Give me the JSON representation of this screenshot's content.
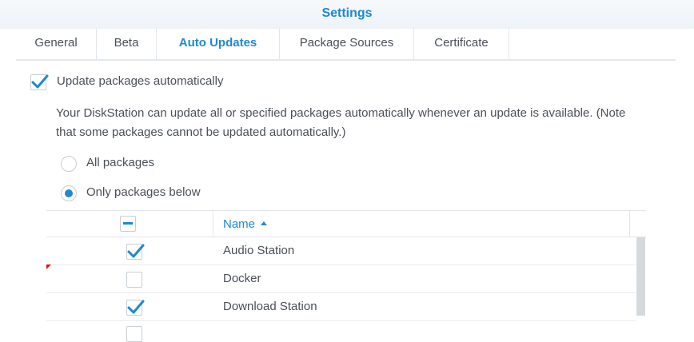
{
  "window": {
    "title": "Settings"
  },
  "tabs": [
    {
      "label": "General"
    },
    {
      "label": "Beta"
    },
    {
      "label": "Auto Updates"
    },
    {
      "label": "Package Sources"
    },
    {
      "label": "Certificate"
    }
  ],
  "auto_update": {
    "enable_label": "Update packages automatically",
    "description": "Your DiskStation can update all or specified packages automatically whenever an update is available. (Note that some packages cannot be updated automatically.)",
    "options": [
      {
        "label": "All packages"
      },
      {
        "label": "Only packages below"
      }
    ]
  },
  "table": {
    "header": {
      "name": "Name"
    },
    "rows": [
      {
        "name": "Audio Station"
      },
      {
        "name": "Docker"
      },
      {
        "name": "Download Station"
      }
    ]
  },
  "colors": {
    "accent": "#1f88d2",
    "text": "#4a4f57",
    "border": "#e2e6ea"
  }
}
